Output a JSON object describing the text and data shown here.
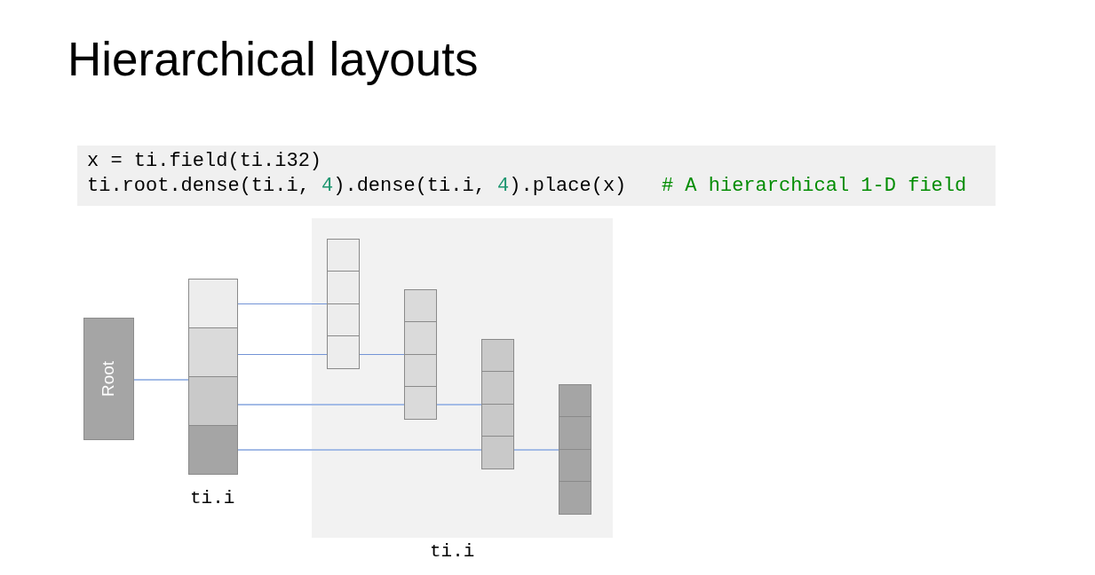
{
  "title": "Hierarchical layouts",
  "code": {
    "lines": [
      {
        "tokens": [
          {
            "kind": "plain",
            "text": "x = ti.field(ti.i32)"
          }
        ]
      },
      {
        "tokens": [
          {
            "kind": "plain",
            "text": "ti.root.dense(ti.i, "
          },
          {
            "kind": "number",
            "text": "4"
          },
          {
            "kind": "plain",
            "text": ").dense(ti.i, "
          },
          {
            "kind": "number",
            "text": "4"
          },
          {
            "kind": "plain",
            "text": ").place(x)   "
          },
          {
            "kind": "comment",
            "text": "# A hierarchical 1-D field"
          }
        ]
      }
    ]
  },
  "diagram": {
    "root": {
      "label": "Root"
    },
    "level_1": {
      "label": "ti.i",
      "cells": [
        {
          "color": "#ededed"
        },
        {
          "color": "#dadada"
        },
        {
          "color": "#c9c9c9"
        },
        {
          "color": "#a5a5a5"
        }
      ]
    },
    "level_2": {
      "label": "ti.i"
    }
  }
}
